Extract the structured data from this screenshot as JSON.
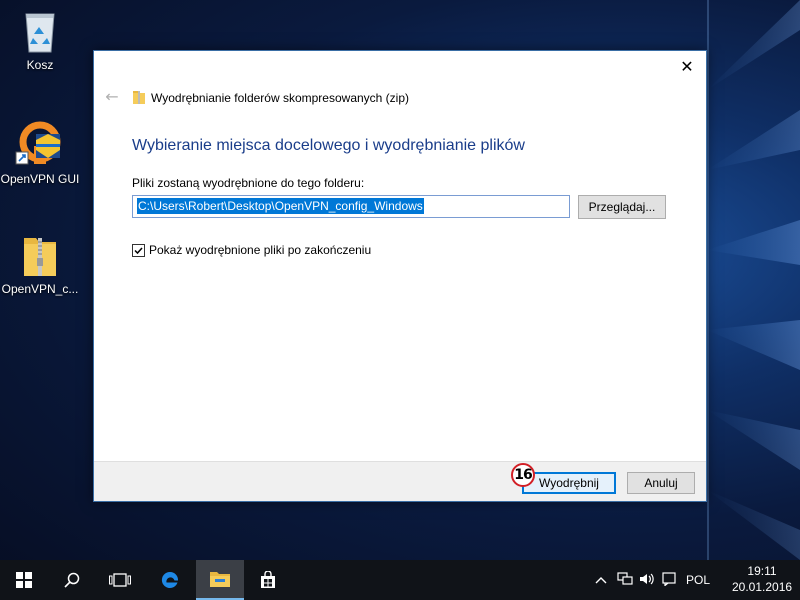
{
  "desktop": {
    "icons": [
      {
        "label": "Kosz",
        "icon": "recycle-bin-icon"
      },
      {
        "label": "OpenVPN GUI",
        "icon": "openvpn-icon"
      },
      {
        "label": "OpenVPN_c...",
        "icon": "zip-folder-icon"
      }
    ]
  },
  "dialog": {
    "title": "Wyodrębnianie folderów skompresowanych (zip)",
    "heading": "Wybieranie miejsca docelowego i wyodrębnianie plików",
    "field_label": "Pliki zostaną wyodrębnione do tego folderu:",
    "path_value": "C:\\Users\\Robert\\Desktop\\OpenVPN_config_Windows",
    "browse_label": "Przeglądaj...",
    "checkbox_label": "Pokaż wyodrębnione pliki po zakończeniu",
    "checkbox_checked": true,
    "extract_label": "Wyodrębnij",
    "cancel_label": "Anuluj",
    "step_number": "16"
  },
  "taskbar": {
    "language": "POL",
    "time": "19:11",
    "date": "20.01.2016"
  },
  "colors": {
    "accent": "#0078d7",
    "heading": "#1a3d8a",
    "badge": "#d21f26"
  }
}
